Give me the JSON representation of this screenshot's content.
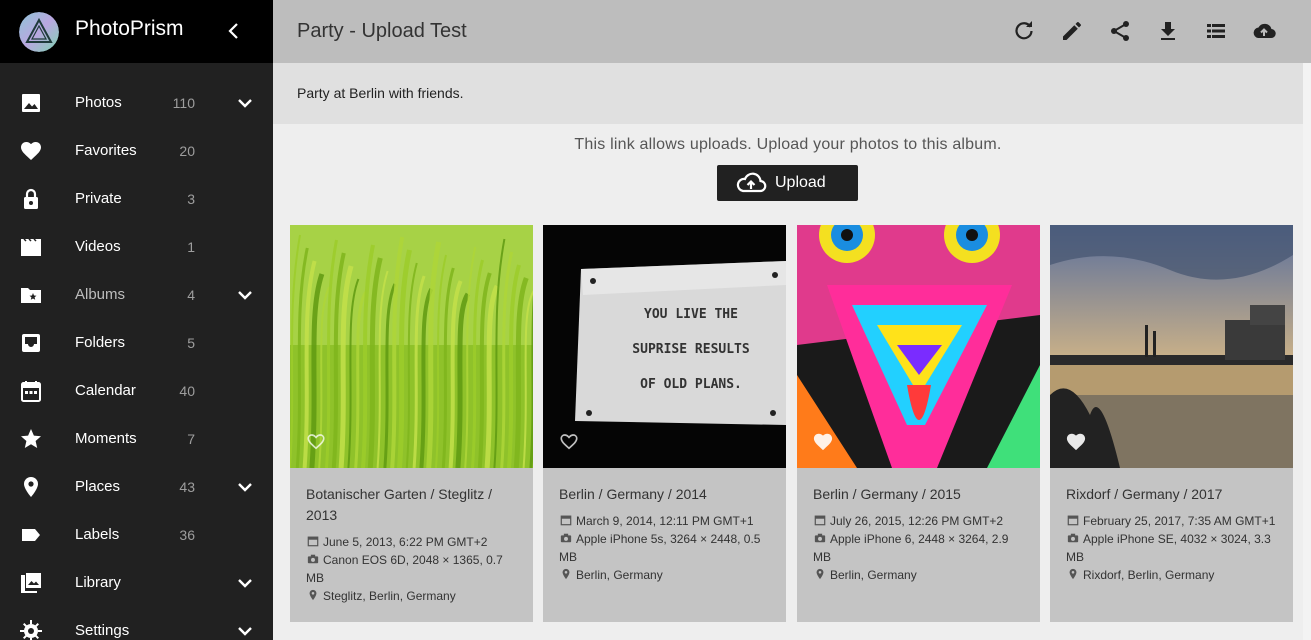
{
  "app": {
    "name": "PhotoPrism"
  },
  "nav": [
    {
      "label": "Photos",
      "count": "110",
      "icon": "image-icon",
      "expand": true
    },
    {
      "label": "Favorites",
      "count": "20",
      "icon": "heart-icon",
      "expand": false
    },
    {
      "label": "Private",
      "count": "3",
      "icon": "lock-icon",
      "expand": false
    },
    {
      "label": "Videos",
      "count": "1",
      "icon": "movie-icon",
      "expand": false
    },
    {
      "label": "Albums",
      "count": "4",
      "icon": "folder-star-icon",
      "expand": true,
      "dim": true
    },
    {
      "label": "Folders",
      "count": "5",
      "icon": "inbox-icon",
      "expand": false
    },
    {
      "label": "Calendar",
      "count": "40",
      "icon": "calendar-icon",
      "expand": false
    },
    {
      "label": "Moments",
      "count": "7",
      "icon": "star-icon",
      "expand": false
    },
    {
      "label": "Places",
      "count": "43",
      "icon": "place-icon",
      "expand": true
    },
    {
      "label": "Labels",
      "count": "36",
      "icon": "label-icon",
      "expand": false
    },
    {
      "label": "Library",
      "count": "",
      "icon": "photo-library-icon",
      "expand": true
    },
    {
      "label": "Settings",
      "count": "",
      "icon": "gear-icon",
      "expand": true
    }
  ],
  "toolbar": {
    "title": "Party - Upload Test",
    "actions": [
      "refresh-icon",
      "edit-icon",
      "share-icon",
      "download-icon",
      "list-view-icon",
      "cloud-upload-icon"
    ]
  },
  "album": {
    "description": "Party at Berlin with friends.",
    "upload_hint": "This link allows uploads. Upload your photos to this album.",
    "upload_label": "Upload"
  },
  "photos": [
    {
      "title": "Botanischer Garten / Steglitz / 2013",
      "date": "June 5, 2013, 6:22 PM GMT+2",
      "camera": "Canon EOS 6D, 2048 × 1365, 0.7 MB",
      "location": "Steglitz, Berlin, Germany",
      "favorite": false
    },
    {
      "title": "Berlin / Germany / 2014",
      "date": "March 9, 2014, 12:11 PM GMT+1",
      "camera": "Apple iPhone 5s, 3264 × 2448, 0.5 MB",
      "location": "Berlin, Germany",
      "favorite": false,
      "sign_lines": [
        "YOU LIVE THE",
        "SUPRISE RESULTS",
        "OF OLD PLANS."
      ]
    },
    {
      "title": "Berlin / Germany / 2015",
      "date": "July 26, 2015, 12:26 PM GMT+2",
      "camera": "Apple iPhone 6, 2448 × 3264, 2.9 MB",
      "location": "Berlin, Germany",
      "favorite": true
    },
    {
      "title": "Rixdorf / Germany / 2017",
      "date": "February 25, 2017, 7:35 AM GMT+1",
      "camera": "Apple iPhone SE, 4032 × 3024, 3.3 MB",
      "location": "Rixdorf, Berlin, Germany",
      "favorite": true
    }
  ],
  "colors": {
    "sidebar": "#212121",
    "toolbar": "#bdbdbd",
    "card": "#c4c4c4",
    "button": "#212121"
  }
}
